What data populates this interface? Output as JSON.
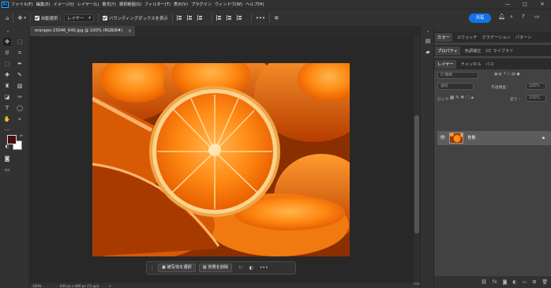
{
  "menu": {
    "items": [
      "ファイル(F)",
      "編集(E)",
      "イメージ(I)",
      "レイヤー(L)",
      "書式(Y)",
      "選択範囲(S)",
      "フィルター(T)",
      "表示(V)",
      "プラグイン",
      "ウィンドウ(W)",
      "ヘルプ(H)"
    ],
    "window_controls": [
      "—",
      "□",
      "✕"
    ]
  },
  "options_bar": {
    "auto_select_label": "自動選択 :",
    "auto_select_value": "レイヤー",
    "bounding_box_label": "バウンディングボックスを表示",
    "more": "•••",
    "share_label": "共有"
  },
  "document": {
    "tab_title": "oranges-15046_640.jpg @ 100% (RGB/8#)",
    "close": "×"
  },
  "status": {
    "zoom": "100%",
    "dimensions": "640 px x 480 px (72 ppi)",
    "arrow": ">"
  },
  "taskbar": {
    "select_subject": "被写体を選択",
    "remove_background": "背景を削除",
    "more": "•••"
  },
  "panels": {
    "color_tabs": [
      "カラー",
      "スウォッチ",
      "グラデーション",
      "パターン"
    ],
    "props_tabs": [
      "プロパティ",
      "色調補正",
      "CC ライブラリ"
    ],
    "layer_tabs": [
      "レイヤー",
      "チャンネル",
      "パス"
    ],
    "kind_label": "Q 種類",
    "blend_mode": "通常",
    "opacity_label": "不透明度 :",
    "opacity_value": "100%",
    "lock_label": "ロック :",
    "fill_label": "塗り :",
    "fill_value": "100%",
    "layer_name": "背景"
  },
  "colors": {
    "accent": "#1473e6",
    "foreground": "#4a0f0f",
    "background": "#ffffff"
  }
}
